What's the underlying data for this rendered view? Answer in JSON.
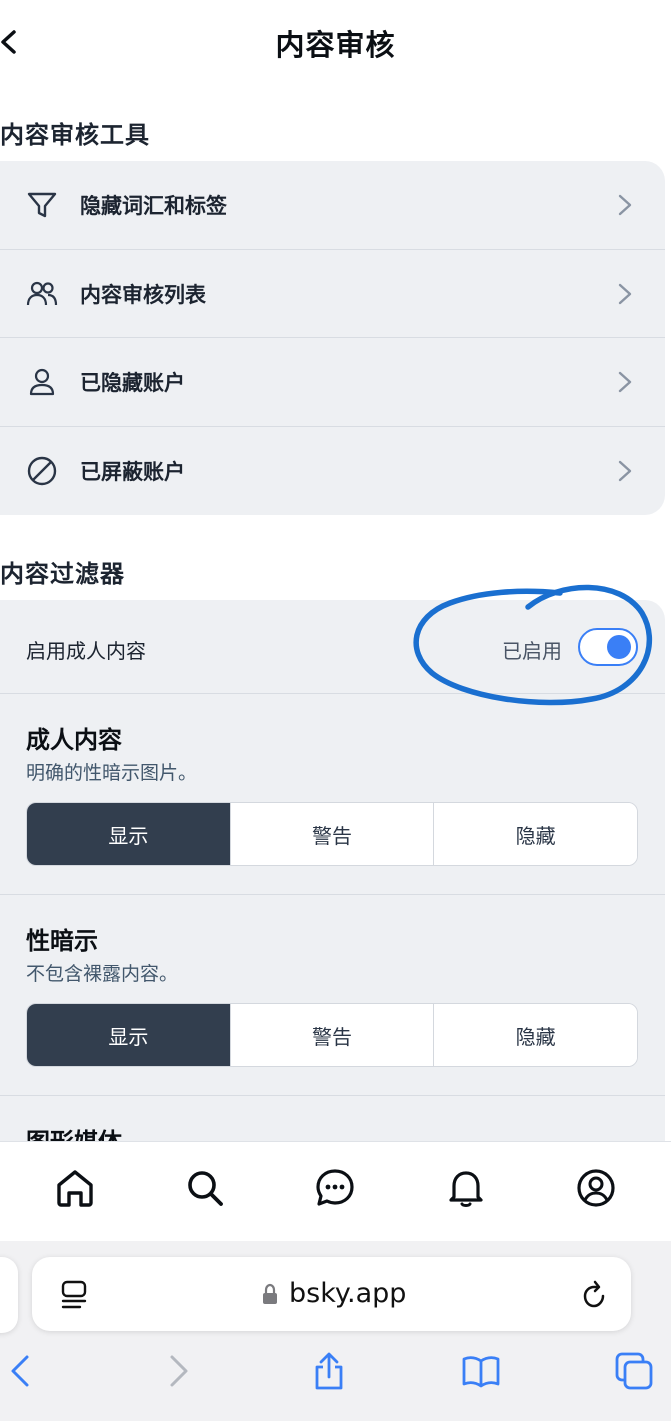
{
  "header": {
    "title": "内容审核"
  },
  "tools_section": {
    "title": "内容审核工具",
    "items": [
      {
        "label": "隐藏词汇和标签",
        "icon": "filter-icon"
      },
      {
        "label": "内容审核列表",
        "icon": "users-icon"
      },
      {
        "label": "已隐藏账户",
        "icon": "person-icon"
      },
      {
        "label": "已屏蔽账户",
        "icon": "block-icon"
      }
    ]
  },
  "filters_section": {
    "title": "内容过滤器",
    "adult_toggle": {
      "label": "启用成人内容",
      "status": "已启用",
      "enabled": true
    },
    "filters": [
      {
        "title": "成人内容",
        "description": "明确的性暗示图片。",
        "options": [
          "显示",
          "警告",
          "隐藏"
        ],
        "selected": "显示"
      },
      {
        "title": "性暗示",
        "description": "不包含裸露内容。",
        "options": [
          "显示",
          "警告",
          "隐藏"
        ],
        "selected": "显示"
      }
    ],
    "partial_title": "图形媒体"
  },
  "tabbar": {
    "items": [
      "home-icon",
      "search-icon",
      "chat-icon",
      "bell-icon",
      "profile-icon"
    ]
  },
  "browser": {
    "url": "bsky.app",
    "toolbar": [
      "back-icon",
      "forward-icon",
      "share-icon",
      "bookmarks-icon",
      "tabs-icon"
    ]
  },
  "colors": {
    "accent": "#3a7ff6",
    "active_segment": "#323e4e",
    "card_bg": "#eef0f3",
    "annotation": "#1a6fd0"
  }
}
